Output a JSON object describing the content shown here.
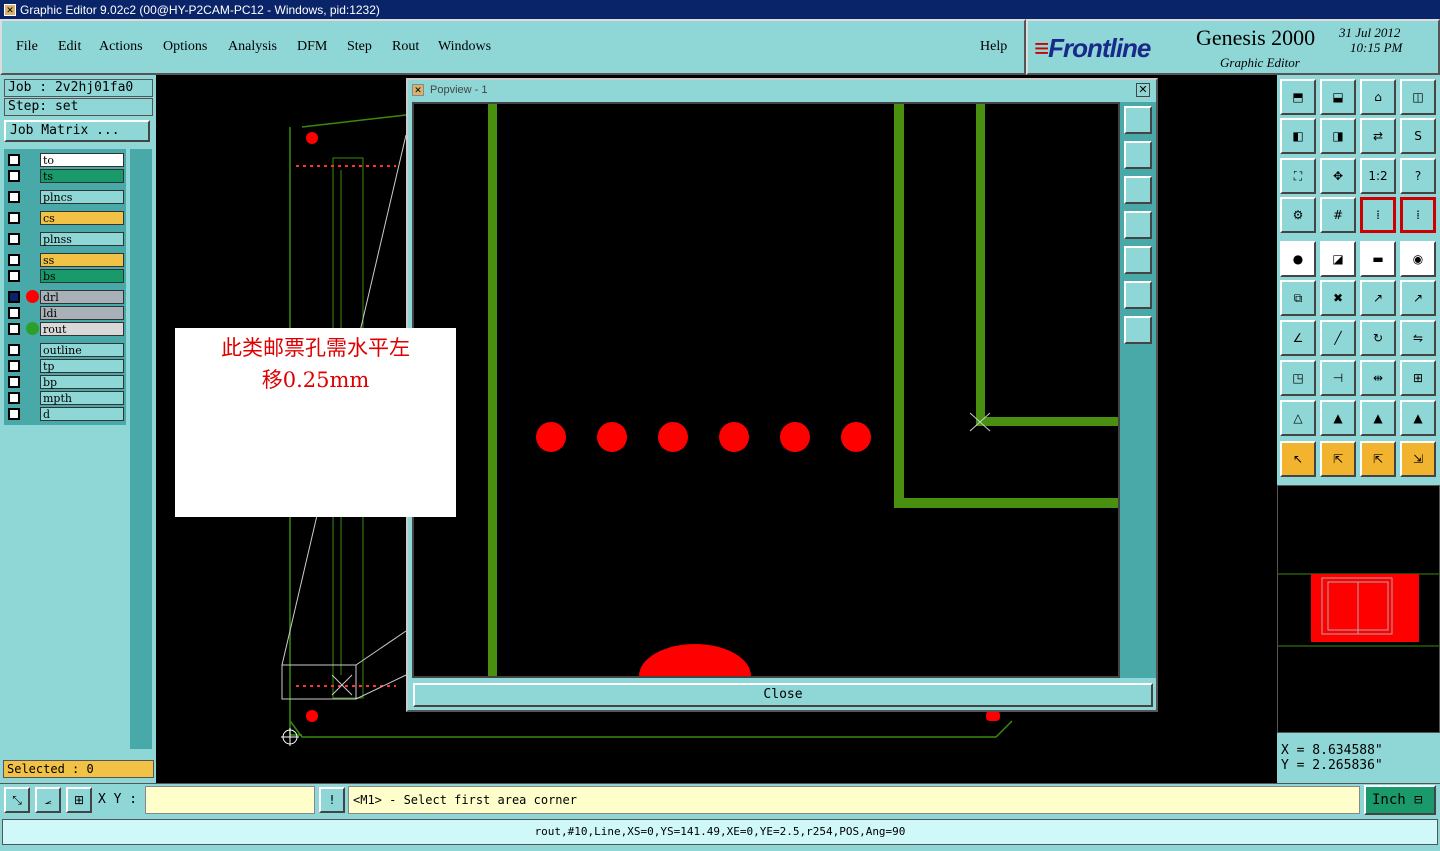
{
  "window": {
    "title": "Graphic Editor 9.02c2 (00@HY-P2CAM-PC12 - Windows, pid:1232)"
  },
  "menu": {
    "items": [
      "File",
      "Edit",
      "Actions",
      "Options",
      "Analysis",
      "DFM",
      "Step",
      "Rout",
      "Windows"
    ],
    "help": "Help"
  },
  "brand": {
    "logo": "Frontline",
    "product": "Genesis 2000",
    "subtitle": "Graphic Editor",
    "date": "31 Jul 2012",
    "time": "10:15 PM"
  },
  "job": {
    "label": "Job : 2v2hj01fa0",
    "step": "Step: set",
    "matrix_button": "Job Matrix ..."
  },
  "layers": [
    {
      "name": "to",
      "color": "#ffffff"
    },
    {
      "name": "ts",
      "color": "#1a9a6a"
    },
    {
      "name": "plncs",
      "color": "#8fd6d6"
    },
    {
      "name": "cs",
      "color": "#f2c246"
    },
    {
      "name": "plnss",
      "color": "#8fd6d6"
    },
    {
      "name": "ss",
      "color": "#f2c246"
    },
    {
      "name": "bs",
      "color": "#1a9a6a"
    },
    {
      "name": "drl",
      "color": "#a8b0b8"
    },
    {
      "name": "ldi",
      "color": "#a8b0b8"
    },
    {
      "name": "rout",
      "color": "#d8d8d8"
    },
    {
      "name": "outline",
      "color": "#8fd6d6"
    },
    {
      "name": "tp",
      "color": "#8fd6d6"
    },
    {
      "name": "bp",
      "color": "#8fd6d6"
    },
    {
      "name": "mpth",
      "color": "#8fd6d6"
    },
    {
      "name": "d",
      "color": "#8fd6d6"
    }
  ],
  "selected": "Selected : 0",
  "popup": {
    "title": "Popview - 1",
    "close_label": "Close"
  },
  "note": {
    "line1": "此类邮票孔需水平左",
    "line2": "移0.25mm"
  },
  "coords": {
    "x": "X = 8.634588\"",
    "y": "Y = 2.265836\""
  },
  "bottom": {
    "xy_label": "X Y :",
    "xy_value": "",
    "prompt": "<M1> - Select first area corner",
    "units": "Inch"
  },
  "status": "rout,#10,Line,XS=0,YS=141.49,XE=0,YE=2.5,r254,POS,Ang=90",
  "colors": {
    "panel": "#8fd6d6",
    "trace": "#3a8a10",
    "pad": "#ff0000"
  }
}
